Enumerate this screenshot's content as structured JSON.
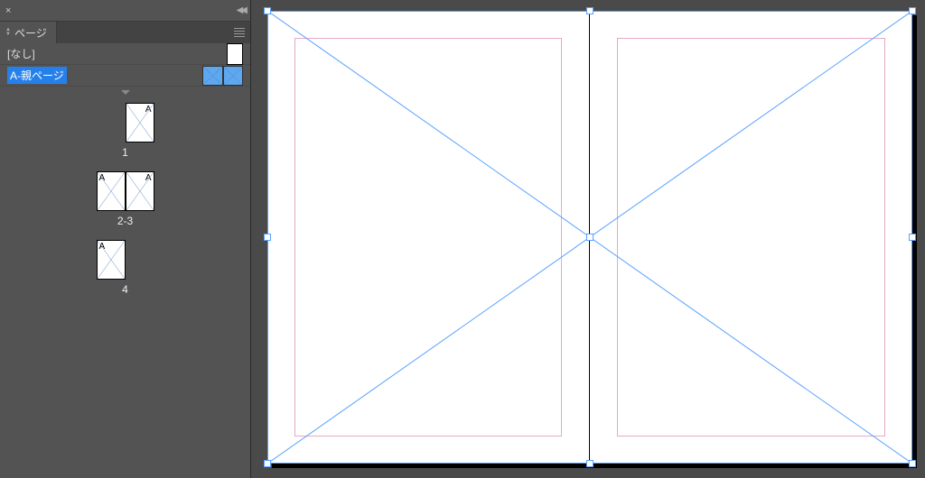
{
  "panel": {
    "title": "ページ",
    "masters": [
      {
        "label": "[なし]",
        "selected": false,
        "type": "single"
      },
      {
        "label": "A-親ページ",
        "selected": true,
        "type": "spread"
      }
    ],
    "pages": [
      {
        "label": "1",
        "type": "single",
        "prefix_right": "A"
      },
      {
        "label": "2-3",
        "type": "spread",
        "prefix_left": "A",
        "prefix_right": "A"
      },
      {
        "label": "4",
        "type": "single-left",
        "prefix_left": "A"
      }
    ]
  },
  "canvas": {
    "selection_handles": true
  }
}
